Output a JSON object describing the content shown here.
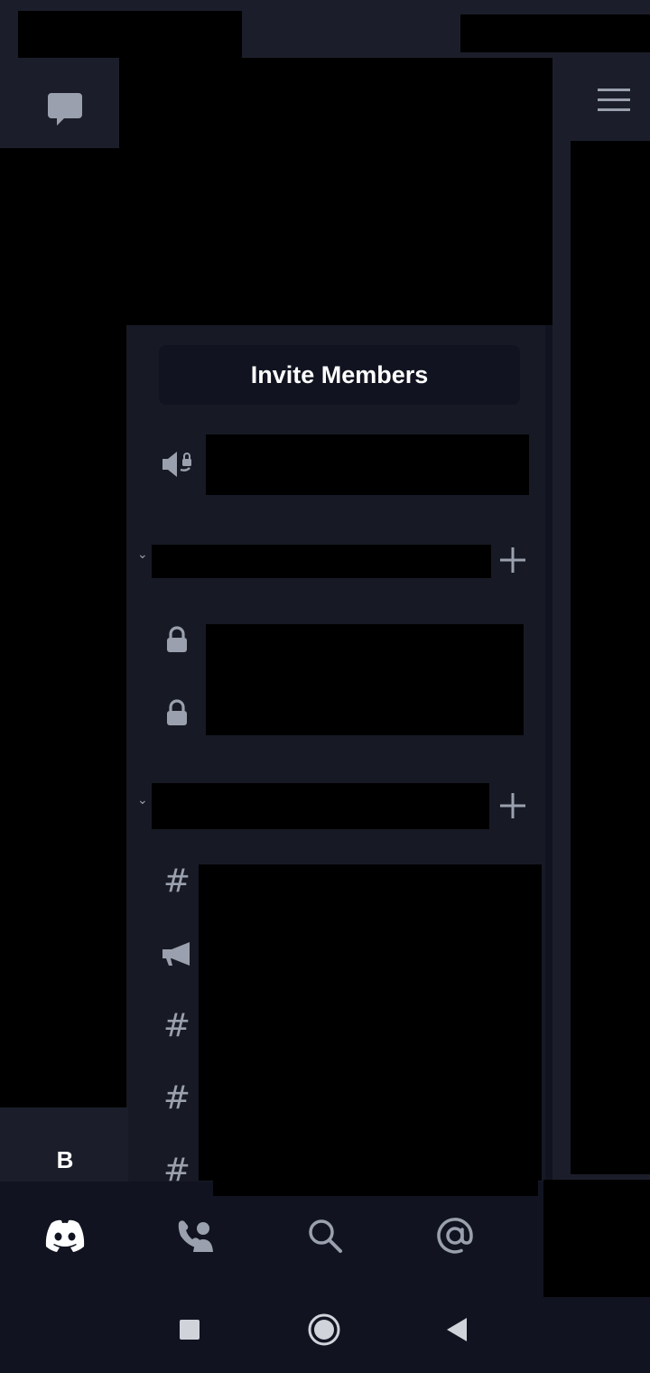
{
  "header": {
    "invite_label": "Invite Members"
  },
  "guild": {
    "letter": "B"
  },
  "icons": {
    "dm": "chat-bubble-icon",
    "menu": "hamburger-menu-icon",
    "voice_locked": "speaker-lock-icon",
    "lock": "lock-icon",
    "hash": "hash-icon",
    "announcement": "megaphone-icon",
    "home": "discord-logo-icon",
    "friends": "friends-call-icon",
    "search": "search-icon",
    "mentions": "at-sign-icon"
  },
  "channels": {
    "hash_symbol": "#",
    "chevron": "⌄"
  },
  "colors": {
    "background": "#000000",
    "panel": "#171a25",
    "surface": "#1b1e2a",
    "nav": "#111420",
    "icon_gray": "#9aa0ad",
    "text": "#ffffff"
  }
}
